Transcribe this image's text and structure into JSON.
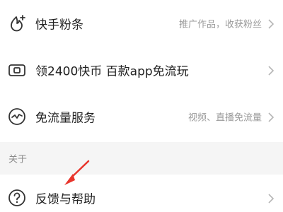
{
  "menu": {
    "items": [
      {
        "label": "快手粉条",
        "hint": "推广作品，收获粉丝",
        "icon": "flame-plus-icon"
      },
      {
        "label": "领2400快币 百款app免流玩",
        "hint": "",
        "icon": "ticket-icon"
      },
      {
        "label": "免流量服务",
        "hint": "视频、直播免流量",
        "icon": "pulse-circle-icon"
      }
    ]
  },
  "about_section": {
    "title": "关于",
    "items": [
      {
        "label": "反馈与帮助",
        "icon": "help-circle-icon"
      }
    ]
  },
  "colors": {
    "text": "#222222",
    "hint": "#9a9a9a",
    "section_bg": "#f5f5f5",
    "annotation_arrow": "#e8352c"
  }
}
